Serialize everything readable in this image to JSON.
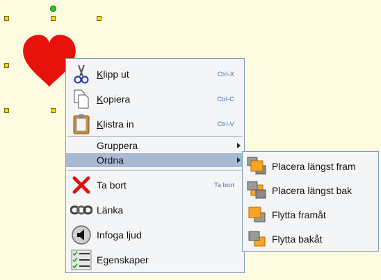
{
  "colors": {
    "background": "#fdfce0",
    "heart": "#e8120c",
    "handle": "#ffd700",
    "rotation_handle": "#22cc22",
    "menu_bg": "#f4f5f7",
    "menu_border": "#7f9db9",
    "highlight": "#a8b9d4",
    "shortcut_text": "#4a6fb5"
  },
  "canvas": {
    "shape": "heart",
    "selected": true
  },
  "context_menu": {
    "items": [
      {
        "label": "Klipp ut",
        "mnemonic": "K",
        "rest": "lipp ut",
        "shortcut": "Ctrl-X",
        "icon": "scissors-icon"
      },
      {
        "label": "Kopiera",
        "mnemonic": "K",
        "rest": "opiera",
        "shortcut": "Ctrl-C",
        "icon": "copy-icon"
      },
      {
        "label": "Klistra in",
        "mnemonic": "K",
        "rest": "listra in",
        "shortcut": "Ctrl-V",
        "icon": "paste-icon"
      },
      {
        "label": "Gruppera",
        "submenu": true
      },
      {
        "label": "Ordna",
        "submenu": true,
        "highlighted": true
      },
      {
        "label": "Ta bort",
        "shortcut": "Ta bort",
        "icon": "delete-x-icon"
      },
      {
        "label": "Länka",
        "icon": "link-chain-icon"
      },
      {
        "label": "Infoga ljud",
        "icon": "speaker-icon"
      },
      {
        "label": "Egenskaper",
        "icon": "properties-list-icon"
      }
    ]
  },
  "arrange_submenu": {
    "items": [
      {
        "label": "Placera längst fram",
        "icon": "bring-to-front-icon"
      },
      {
        "label": "Placera längst bak",
        "icon": "send-to-back-icon"
      },
      {
        "label": "Flytta framåt",
        "icon": "bring-forward-icon"
      },
      {
        "label": "Flytta bakåt",
        "icon": "send-backward-icon"
      }
    ]
  }
}
